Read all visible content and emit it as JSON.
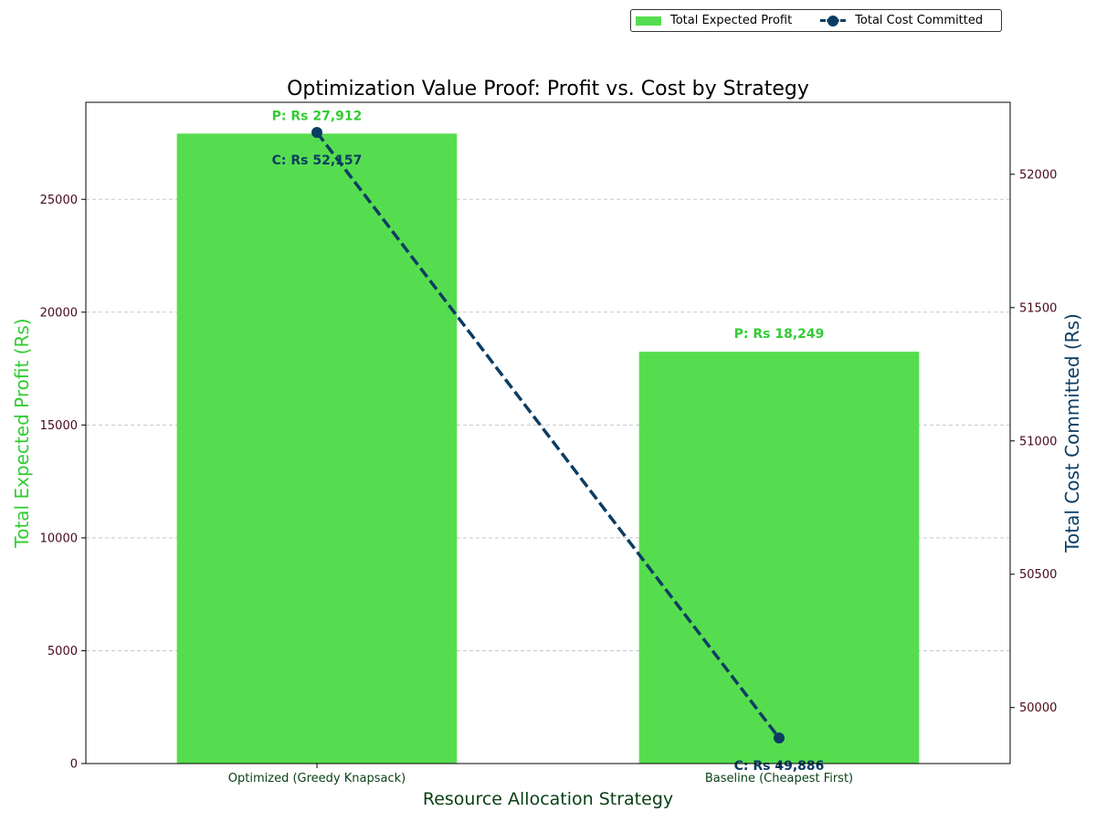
{
  "chart_data": {
    "type": "bar",
    "title": "Optimization Value Proof: Profit vs. Cost by Strategy",
    "xlabel": "Resource Allocation Strategy",
    "ylabel": "Total Expected Profit (Rs)",
    "y2label": "Total Cost Committed (Rs)",
    "categories": [
      "Optimized (Greedy Knapsack)",
      "Baseline (Cheapest First)"
    ],
    "series": [
      {
        "name": "Total Expected Profit",
        "type": "bar",
        "axis": "left",
        "color": "#56dd4f",
        "values": [
          27912,
          18249
        ],
        "labels": [
          "P: Rs 27,912",
          "P: Rs 18,249"
        ]
      },
      {
        "name": "Total Cost Committed",
        "type": "line",
        "axis": "right",
        "style": "dashed",
        "marker": "circle",
        "color": "#0b3d63",
        "values": [
          52157,
          49886
        ],
        "labels": [
          "C: Rs 52,157",
          "C: Rs 49,886"
        ]
      }
    ],
    "ylim": [
      0,
      29300
    ],
    "y2lim": [
      49790,
      52270
    ],
    "yticks": [
      0,
      5000,
      10000,
      15000,
      20000,
      25000
    ],
    "y2ticks": [
      50000,
      50500,
      51000,
      51500,
      52000
    ],
    "grid": "horizontal dashed",
    "legend_position": "top-right, outside"
  },
  "colors": {
    "profit_label": "#33cc33",
    "cost_label": "#0b3d63",
    "tick_text": "#4a0a1a",
    "xlabel_text": "#0b4016"
  }
}
